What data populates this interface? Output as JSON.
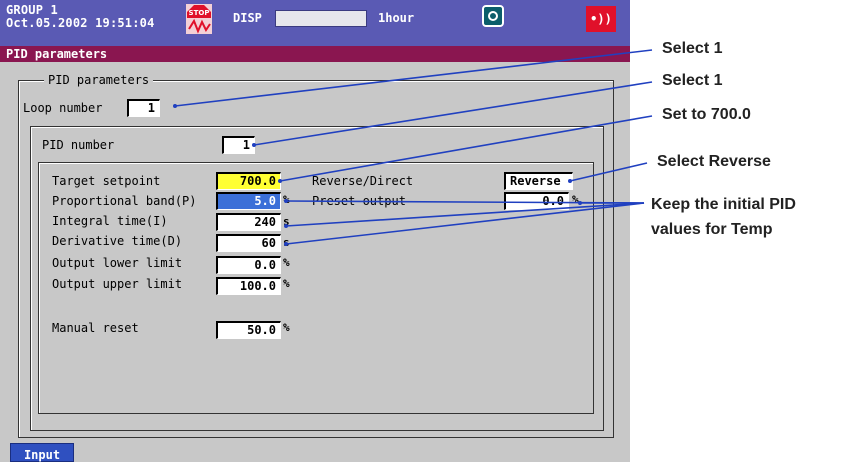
{
  "status_bar": {
    "group": "GROUP 1",
    "datetime": "Oct.05.2002 19:51:04",
    "stop_icon_text": "STOP",
    "disp_label": "DISP",
    "interval": "1hour",
    "alarm_icon": "•))"
  },
  "title": "PID parameters",
  "section": {
    "legend": "PID parameters",
    "loop_label": "Loop number",
    "loop_value": "1",
    "pid_label": "PID number",
    "pid_value": "1"
  },
  "params": {
    "target_setpoint": {
      "label": "Target setpoint",
      "value": "700.0"
    },
    "proportional_band": {
      "label": "Proportional band(P)",
      "value": "5.0",
      "unit": "%"
    },
    "integral_time": {
      "label": "Integral time(I)",
      "value": "240",
      "unit": "s"
    },
    "derivative_time": {
      "label": "Derivative time(D)",
      "value": "60",
      "unit": "s"
    },
    "output_lower": {
      "label": "Output lower limit",
      "value": "0.0",
      "unit": "%"
    },
    "output_upper": {
      "label": "Output upper limit",
      "value": "100.0",
      "unit": "%"
    },
    "manual_reset": {
      "label": "Manual reset",
      "value": "50.0",
      "unit": "%"
    },
    "reverse_direct": {
      "label": "Reverse/Direct",
      "value": "Reverse"
    },
    "preset_output": {
      "label": "Preset output",
      "value": "0.0",
      "unit": "%"
    }
  },
  "softkey": "Input",
  "annotations": {
    "select_loop": "Select 1",
    "select_pid": "Select 1",
    "set_target": "Set to 700.0",
    "select_reverse": "Select Reverse",
    "keep_pid_line1": "Keep the initial PID",
    "keep_pid_line2": "values for Temp"
  },
  "colors": {
    "topbar": "#5a5ab4",
    "titlebar": "#8a1650",
    "highlight_yellow": "#ffff33",
    "highlight_blue": "#3b6fd8",
    "alarm_red": "#e0102a"
  }
}
